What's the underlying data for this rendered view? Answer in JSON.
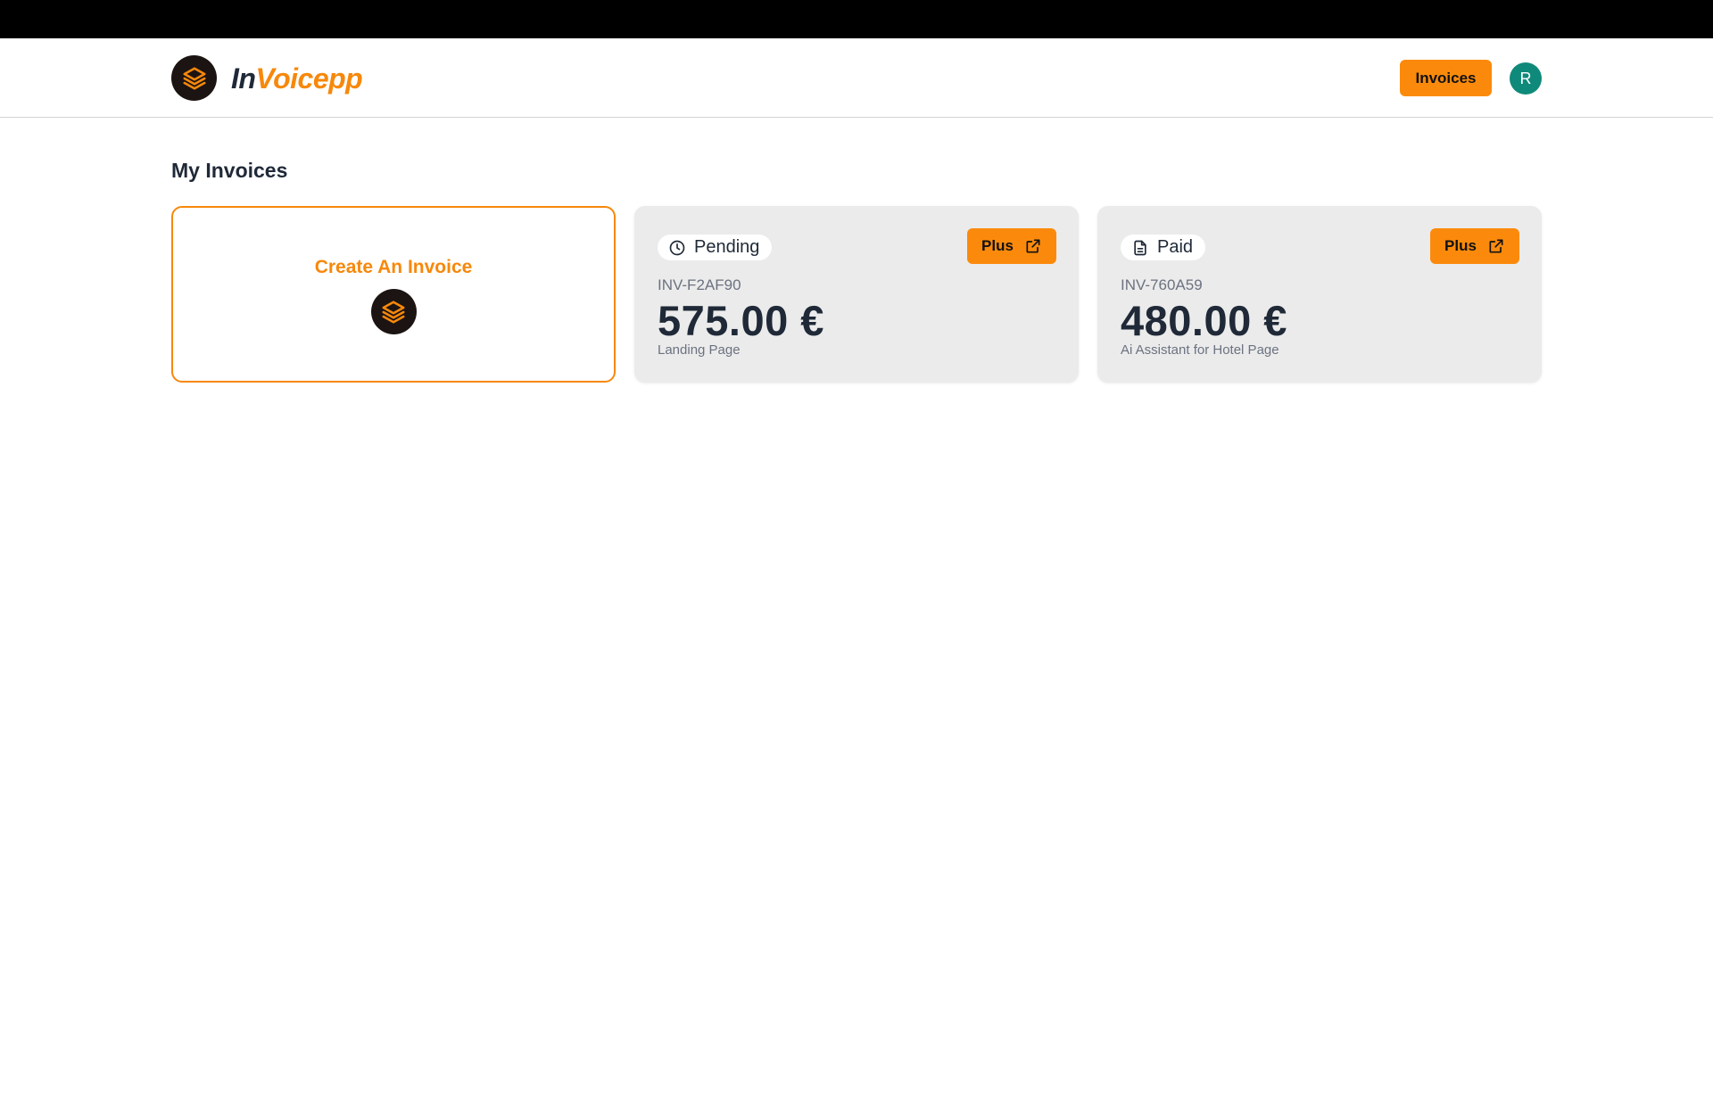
{
  "app": {
    "name_part1": "In",
    "name_part2": "Voicepp",
    "logo_icon": "layers-icon"
  },
  "colors": {
    "accent": "#fb8a0c",
    "brand_orange": "#f7880b",
    "dark": "#1f2937",
    "avatar_bg": "#0f8a7a",
    "card_bg": "#ebebeb"
  },
  "header": {
    "invoices_button": "Invoices",
    "avatar_initial": "R"
  },
  "main": {
    "title": "My Invoices",
    "create_card": {
      "label": "Create An Invoice",
      "icon": "layers-icon"
    },
    "invoices": [
      {
        "status": "Pending",
        "status_icon": "clock-icon",
        "button_label": "Plus",
        "button_icon": "external-link-icon",
        "number": "INV-F2AF90",
        "amount": "575.00 €",
        "description": "Landing Page"
      },
      {
        "status": "Paid",
        "status_icon": "document-icon",
        "button_label": "Plus",
        "button_icon": "external-link-icon",
        "number": "INV-760A59",
        "amount": "480.00 €",
        "description": "Ai Assistant for Hotel Page"
      }
    ]
  }
}
